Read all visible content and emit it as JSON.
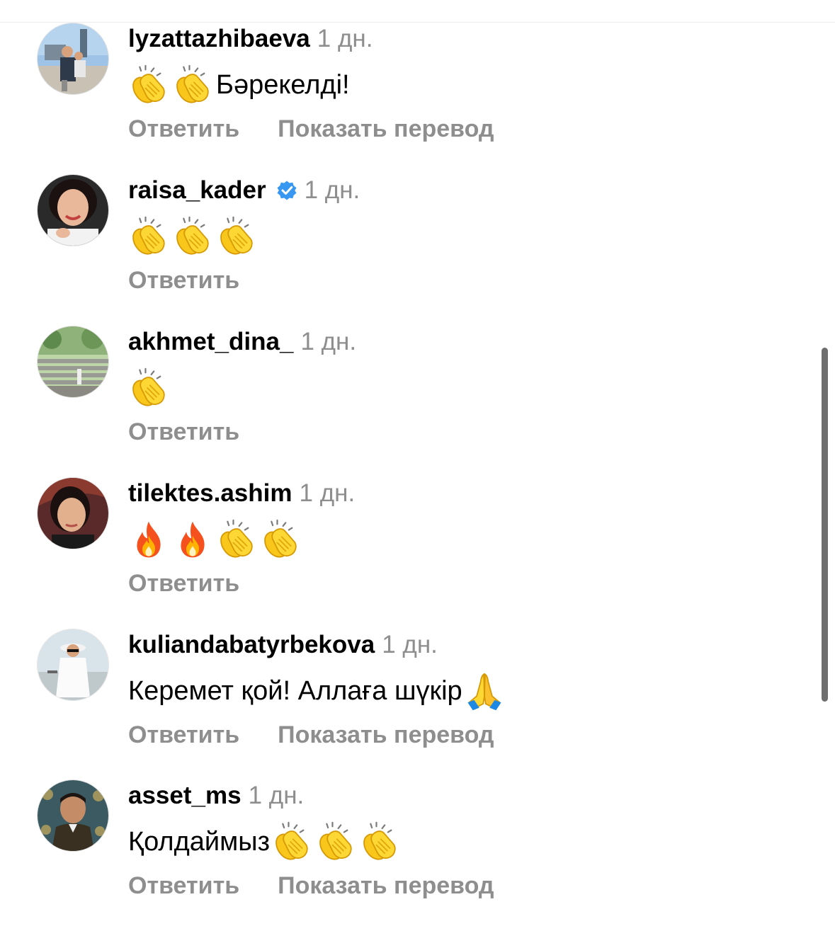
{
  "comments": [
    {
      "username": "lyzattazhibaeva",
      "time": "1 дн.",
      "verified": false,
      "parts": [
        {
          "kind": "emoji",
          "icon": "clapping-hands"
        },
        {
          "kind": "emoji",
          "icon": "clapping-hands"
        },
        {
          "kind": "text",
          "value": "Бәрекелді!"
        }
      ],
      "reply_label": "Ответить",
      "translate_label": "Показать перевод"
    },
    {
      "username": "raisa_kader",
      "time": "1 дн.",
      "verified": true,
      "parts": [
        {
          "kind": "emoji",
          "icon": "clapping-hands"
        },
        {
          "kind": "emoji",
          "icon": "clapping-hands"
        },
        {
          "kind": "emoji",
          "icon": "clapping-hands"
        }
      ],
      "reply_label": "Ответить",
      "translate_label": ""
    },
    {
      "username": "akhmet_dina_",
      "time": "1 дн.",
      "verified": false,
      "parts": [
        {
          "kind": "emoji",
          "icon": "clapping-hands"
        }
      ],
      "reply_label": "Ответить",
      "translate_label": ""
    },
    {
      "username": "tilektes.ashim",
      "time": "1 дн.",
      "verified": false,
      "parts": [
        {
          "kind": "emoji",
          "icon": "fire"
        },
        {
          "kind": "emoji",
          "icon": "fire"
        },
        {
          "kind": "emoji",
          "icon": "clapping-hands"
        },
        {
          "kind": "emoji",
          "icon": "clapping-hands"
        }
      ],
      "reply_label": "Ответить",
      "translate_label": ""
    },
    {
      "username": "kuliandabatyrbekova",
      "time": "1 дн.",
      "verified": false,
      "parts": [
        {
          "kind": "text",
          "value": "Керемет қой! Аллаға шүкір"
        },
        {
          "kind": "emoji",
          "icon": "folded-hands"
        }
      ],
      "reply_label": "Ответить",
      "translate_label": "Показать перевод"
    },
    {
      "username": "asset_ms",
      "time": "1 дн.",
      "verified": false,
      "parts": [
        {
          "kind": "text",
          "value": "Қолдаймыз"
        },
        {
          "kind": "emoji",
          "icon": "clapping-hands"
        },
        {
          "kind": "emoji",
          "icon": "clapping-hands"
        },
        {
          "kind": "emoji",
          "icon": "clapping-hands"
        }
      ],
      "reply_label": "Ответить",
      "translate_label": "Показать перевод"
    }
  ],
  "colors": {
    "username": "#000000",
    "muted": "#8e8e8e",
    "verified_badge": "#3897f0"
  }
}
